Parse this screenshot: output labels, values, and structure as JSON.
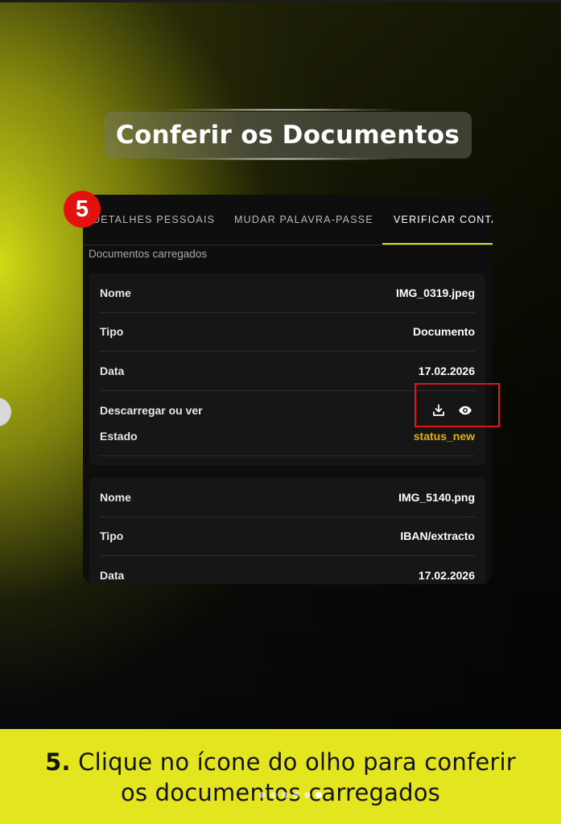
{
  "heading": "Conferir os Documentos",
  "step_badge": "5",
  "tabs": [
    {
      "label": "DETALHES PESSOAIS"
    },
    {
      "label": "MUDAR PALAVRA-PASSE"
    },
    {
      "label": "VERIFICAR CONTA"
    }
  ],
  "section_label": "Documentos carregados",
  "documents": [
    {
      "name_label": "Nome",
      "name": "IMG_0319.jpeg",
      "type_label": "Tipo",
      "type": "Documento",
      "date_label": "Data",
      "date": "17.02.2026",
      "actions_label": "Descarregar ou ver",
      "status_label": "Estado",
      "status": "status_new"
    },
    {
      "name_label": "Nome",
      "name": "IMG_5140.png",
      "type_label": "Tipo",
      "type": "IBAN/extracto",
      "date_label": "Data",
      "date": "17.02.2026"
    }
  ],
  "icons": {
    "download": "download-icon",
    "view": "eye-icon"
  },
  "caption": {
    "number": "5.",
    "line1": "Clique no ícone do olho para conferir",
    "line2": "os documentos carregados"
  },
  "colors": {
    "accent": "#dde11f",
    "status": "#e0b010",
    "badge": "#e3120f",
    "highlight": "#e0151b",
    "band": "#e3e51e"
  }
}
